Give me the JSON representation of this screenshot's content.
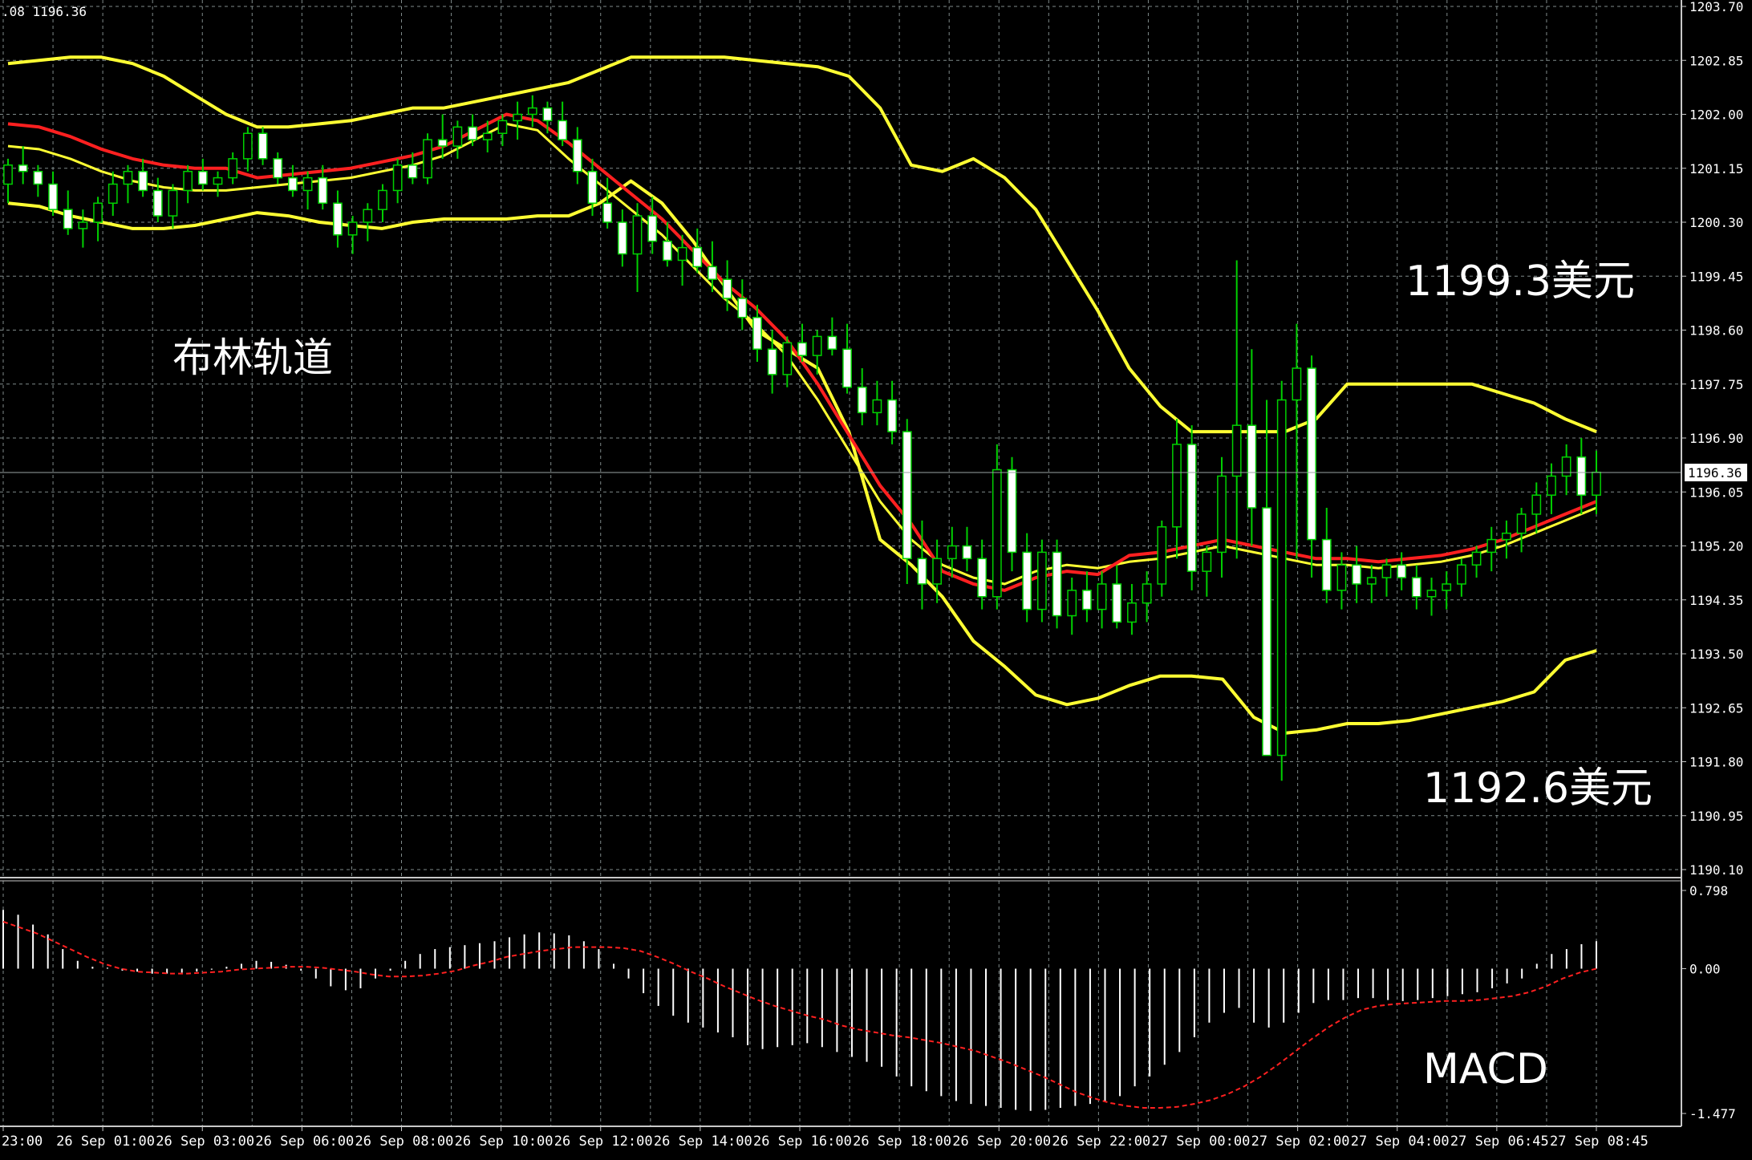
{
  "header": {
    "info": ".08 1196.36"
  },
  "annotations": {
    "bollinger_label": "布林轨道",
    "upper_price": "1199.3美元",
    "lower_price": "1192.6美元",
    "macd_label": "MACD"
  },
  "colors": {
    "background": "#000000",
    "grid": "#7f8a8a",
    "candle_up": "#000000",
    "candle_down": "#ffffff",
    "wick": "#00d000",
    "bollinger": "#ffff33",
    "middle": "#ff2020",
    "macd_signal": "#ff2020",
    "macd_hist": "#ffffff",
    "text": "#ffffff"
  },
  "chart_data": {
    "type": "candlestick",
    "instrument_note": "price chart with Bollinger Bands and MACD",
    "current_price": 1196.36,
    "price_axis": {
      "ylim": [
        1190.1,
        1203.7
      ],
      "ticks": [
        "1203.70",
        "1202.85",
        "1202.00",
        "1201.15",
        "1200.30",
        "1199.45",
        "1198.60",
        "1197.75",
        "1196.90",
        "1196.05",
        "1195.20",
        "1194.35",
        "1193.50",
        "1192.65",
        "1191.80",
        "1190.95",
        "1190.10"
      ]
    },
    "macd_axis": {
      "ylim": [
        -1.477,
        0.798
      ],
      "ticks": [
        "0.798",
        "0.00",
        "-1.477"
      ]
    },
    "time_labels": [
      "23:00",
      "26 Sep 01:00",
      "26 Sep 03:00",
      "26 Sep 06:00",
      "26 Sep 08:00",
      "26 Sep 10:00",
      "26 Sep 12:00",
      "26 Sep 14:00",
      "26 Sep 16:00",
      "26 Sep 18:00",
      "26 Sep 20:00",
      "26 Sep 22:00",
      "27 Sep 00:00",
      "27 Sep 02:00",
      "27 Sep 04:00",
      "27 Sep 06:45",
      "27 Sep 08:45"
    ],
    "candles": [
      [
        1200.9,
        1201.3,
        1200.6,
        1201.2
      ],
      [
        1201.2,
        1201.5,
        1200.9,
        1201.1
      ],
      [
        1201.1,
        1201.2,
        1200.7,
        1200.9
      ],
      [
        1200.9,
        1201.1,
        1200.4,
        1200.5
      ],
      [
        1200.5,
        1200.8,
        1200.1,
        1200.2
      ],
      [
        1200.2,
        1200.5,
        1199.9,
        1200.3
      ],
      [
        1200.3,
        1200.7,
        1200.0,
        1200.6
      ],
      [
        1200.6,
        1201.1,
        1200.4,
        1200.9
      ],
      [
        1200.9,
        1201.2,
        1200.6,
        1201.1
      ],
      [
        1201.1,
        1201.3,
        1200.7,
        1200.8
      ],
      [
        1200.8,
        1201.0,
        1200.3,
        1200.4
      ],
      [
        1200.4,
        1200.9,
        1200.2,
        1200.8
      ],
      [
        1200.8,
        1201.2,
        1200.6,
        1201.1
      ],
      [
        1201.1,
        1201.3,
        1200.8,
        1200.9
      ],
      [
        1200.9,
        1201.1,
        1200.7,
        1201.0
      ],
      [
        1201.0,
        1201.4,
        1200.9,
        1201.3
      ],
      [
        1201.3,
        1201.8,
        1201.1,
        1201.7
      ],
      [
        1201.7,
        1201.8,
        1201.2,
        1201.3
      ],
      [
        1201.3,
        1201.4,
        1200.9,
        1201.0
      ],
      [
        1201.0,
        1201.2,
        1200.7,
        1200.8
      ],
      [
        1200.8,
        1201.1,
        1200.5,
        1201.0
      ],
      [
        1201.0,
        1201.2,
        1200.5,
        1200.6
      ],
      [
        1200.6,
        1200.8,
        1199.9,
        1200.1
      ],
      [
        1200.1,
        1200.4,
        1199.8,
        1200.3
      ],
      [
        1200.3,
        1200.6,
        1200.0,
        1200.5
      ],
      [
        1200.5,
        1200.9,
        1200.3,
        1200.8
      ],
      [
        1200.8,
        1201.3,
        1200.6,
        1201.2
      ],
      [
        1201.2,
        1201.4,
        1200.9,
        1201.0
      ],
      [
        1201.0,
        1201.7,
        1200.9,
        1201.6
      ],
      [
        1201.6,
        1202.0,
        1201.3,
        1201.5
      ],
      [
        1201.5,
        1201.9,
        1201.3,
        1201.8
      ],
      [
        1201.8,
        1202.0,
        1201.5,
        1201.6
      ],
      [
        1201.6,
        1201.9,
        1201.4,
        1201.7
      ],
      [
        1201.7,
        1202.0,
        1201.5,
        1201.9
      ],
      [
        1201.9,
        1202.2,
        1201.6,
        1202.0
      ],
      [
        1202.0,
        1202.3,
        1201.8,
        1202.1
      ],
      [
        1202.1,
        1202.2,
        1201.7,
        1201.9
      ],
      [
        1201.9,
        1202.2,
        1201.5,
        1201.6
      ],
      [
        1201.6,
        1201.8,
        1200.9,
        1201.1
      ],
      [
        1201.1,
        1201.3,
        1200.4,
        1200.6
      ],
      [
        1200.6,
        1201.0,
        1200.2,
        1200.3
      ],
      [
        1200.3,
        1200.5,
        1199.6,
        1199.8
      ],
      [
        1199.8,
        1200.6,
        1199.2,
        1200.4
      ],
      [
        1200.4,
        1200.7,
        1199.8,
        1200.0
      ],
      [
        1200.0,
        1200.3,
        1199.6,
        1199.7
      ],
      [
        1199.7,
        1200.1,
        1199.3,
        1199.9
      ],
      [
        1199.9,
        1200.2,
        1199.5,
        1199.6
      ],
      [
        1199.6,
        1200.0,
        1199.2,
        1199.4
      ],
      [
        1199.4,
        1199.7,
        1198.9,
        1199.1
      ],
      [
        1199.1,
        1199.4,
        1198.6,
        1198.8
      ],
      [
        1198.8,
        1199.0,
        1198.1,
        1198.3
      ],
      [
        1198.3,
        1198.6,
        1197.6,
        1197.9
      ],
      [
        1197.9,
        1198.5,
        1197.7,
        1198.4
      ],
      [
        1198.4,
        1198.7,
        1198.1,
        1198.2
      ],
      [
        1198.2,
        1198.6,
        1197.9,
        1198.5
      ],
      [
        1198.5,
        1198.8,
        1198.2,
        1198.3
      ],
      [
        1198.3,
        1198.7,
        1197.6,
        1197.7
      ],
      [
        1197.7,
        1198.0,
        1197.1,
        1197.3
      ],
      [
        1197.3,
        1197.8,
        1197.1,
        1197.5
      ],
      [
        1197.5,
        1197.8,
        1196.8,
        1197.0
      ],
      [
        1197.0,
        1197.2,
        1194.6,
        1195.0
      ],
      [
        1195.0,
        1195.6,
        1194.2,
        1194.6
      ],
      [
        1194.6,
        1195.3,
        1194.3,
        1195.0
      ],
      [
        1195.0,
        1195.5,
        1194.7,
        1195.2
      ],
      [
        1195.2,
        1195.5,
        1194.8,
        1195.0
      ],
      [
        1195.0,
        1195.3,
        1194.2,
        1194.4
      ],
      [
        1194.4,
        1196.8,
        1194.2,
        1196.4
      ],
      [
        1196.4,
        1196.6,
        1194.8,
        1195.1
      ],
      [
        1195.1,
        1195.4,
        1194.0,
        1194.2
      ],
      [
        1194.2,
        1195.3,
        1194.0,
        1195.1
      ],
      [
        1195.1,
        1195.3,
        1193.9,
        1194.1
      ],
      [
        1194.1,
        1194.7,
        1193.8,
        1194.5
      ],
      [
        1194.5,
        1194.8,
        1194.0,
        1194.2
      ],
      [
        1194.2,
        1194.8,
        1193.9,
        1194.6
      ],
      [
        1194.6,
        1194.9,
        1193.9,
        1194.0
      ],
      [
        1194.0,
        1194.6,
        1193.8,
        1194.3
      ],
      [
        1194.3,
        1194.8,
        1194.0,
        1194.6
      ],
      [
        1194.6,
        1195.6,
        1194.4,
        1195.5
      ],
      [
        1195.5,
        1197.2,
        1195.0,
        1196.8
      ],
      [
        1196.8,
        1197.1,
        1194.5,
        1194.8
      ],
      [
        1194.8,
        1195.2,
        1194.4,
        1195.1
      ],
      [
        1195.1,
        1196.6,
        1194.7,
        1196.3
      ],
      [
        1196.3,
        1199.7,
        1195.0,
        1197.1
      ],
      [
        1197.1,
        1198.3,
        1195.2,
        1195.8
      ],
      [
        1195.8,
        1197.5,
        1193.2,
        1191.9
      ],
      [
        1191.9,
        1197.8,
        1191.5,
        1197.5
      ],
      [
        1197.5,
        1198.7,
        1195.0,
        1198.0
      ],
      [
        1198.0,
        1198.2,
        1194.7,
        1195.3
      ],
      [
        1195.3,
        1195.8,
        1194.3,
        1194.5
      ],
      [
        1194.5,
        1195.1,
        1194.2,
        1194.9
      ],
      [
        1194.9,
        1195.2,
        1194.3,
        1194.6
      ],
      [
        1194.6,
        1194.9,
        1194.3,
        1194.7
      ],
      [
        1194.7,
        1195.0,
        1194.4,
        1194.9
      ],
      [
        1194.9,
        1195.1,
        1194.5,
        1194.7
      ],
      [
        1194.7,
        1194.9,
        1194.2,
        1194.4
      ],
      [
        1194.4,
        1194.7,
        1194.1,
        1194.5
      ],
      [
        1194.5,
        1194.8,
        1194.2,
        1194.6
      ],
      [
        1194.6,
        1195.0,
        1194.4,
        1194.9
      ],
      [
        1194.9,
        1195.2,
        1194.7,
        1195.1
      ],
      [
        1195.1,
        1195.5,
        1194.8,
        1195.3
      ],
      [
        1195.3,
        1195.6,
        1195.0,
        1195.4
      ],
      [
        1195.4,
        1195.8,
        1195.1,
        1195.7
      ],
      [
        1195.7,
        1196.2,
        1195.4,
        1196.0
      ],
      [
        1196.0,
        1196.5,
        1195.7,
        1196.3
      ],
      [
        1196.3,
        1196.8,
        1196.0,
        1196.6
      ],
      [
        1196.6,
        1196.9,
        1195.7,
        1196.0
      ],
      [
        1196.0,
        1196.7,
        1195.7,
        1196.36
      ]
    ],
    "bollinger_upper": [
      1202.8,
      1202.85,
      1202.9,
      1202.9,
      1202.8,
      1202.6,
      1202.3,
      1202.0,
      1201.8,
      1201.8,
      1201.85,
      1201.9,
      1202.0,
      1202.1,
      1202.1,
      1202.2,
      1202.3,
      1202.4,
      1202.5,
      1202.7,
      1202.9,
      1202.9,
      1202.9,
      1202.9,
      1202.85,
      1202.8,
      1202.75,
      1202.6,
      1202.1,
      1201.2,
      1201.1,
      1201.3,
      1201.0,
      1200.5,
      1199.7,
      1198.9,
      1198.0,
      1197.4,
      1197.0,
      1197.0,
      1197.0,
      1197.0,
      1197.2,
      1197.75,
      1197.75,
      1197.75,
      1197.75,
      1197.75,
      1197.6,
      1197.45,
      1197.2,
      1197.0
    ],
    "bollinger_middle": [
      1201.5,
      1201.45,
      1201.3,
      1201.1,
      1200.95,
      1200.85,
      1200.8,
      1200.8,
      1200.85,
      1200.9,
      1200.95,
      1201.0,
      1201.1,
      1201.2,
      1201.35,
      1201.6,
      1201.85,
      1201.75,
      1201.3,
      1200.9,
      1200.5,
      1200.1,
      1199.6,
      1199.1,
      1198.7,
      1198.2,
      1197.5,
      1196.7,
      1195.9,
      1195.3,
      1194.9,
      1194.7,
      1194.6,
      1194.8,
      1194.9,
      1194.85,
      1194.95,
      1195.0,
      1195.1,
      1195.2,
      1195.1,
      1195.0,
      1194.9,
      1194.9,
      1194.85,
      1194.9,
      1194.95,
      1195.05,
      1195.2,
      1195.4,
      1195.6,
      1195.8
    ],
    "bollinger_lower": [
      1200.6,
      1200.55,
      1200.4,
      1200.3,
      1200.2,
      1200.2,
      1200.25,
      1200.35,
      1200.45,
      1200.4,
      1200.3,
      1200.25,
      1200.2,
      1200.3,
      1200.35,
      1200.35,
      1200.35,
      1200.4,
      1200.4,
      1200.6,
      1200.95,
      1200.6,
      1200.0,
      1199.3,
      1198.6,
      1198.3,
      1198.0,
      1197.0,
      1195.3,
      1194.9,
      1194.4,
      1193.7,
      1193.3,
      1192.85,
      1192.7,
      1192.8,
      1193.0,
      1193.15,
      1193.15,
      1193.1,
      1192.5,
      1192.25,
      1192.3,
      1192.4,
      1192.4,
      1192.45,
      1192.55,
      1192.65,
      1192.75,
      1192.9,
      1193.4,
      1193.55
    ],
    "macd_hist": [
      0.6,
      0.55,
      0.45,
      0.35,
      0.2,
      0.08,
      0.02,
      0.01,
      -0.02,
      -0.03,
      -0.05,
      -0.05,
      -0.04,
      -0.03,
      -0.01,
      0.02,
      0.05,
      0.08,
      0.07,
      0.04,
      -0.02,
      -0.1,
      -0.18,
      -0.22,
      -0.2,
      -0.1,
      -0.02,
      0.08,
      0.15,
      0.2,
      0.22,
      0.24,
      0.26,
      0.28,
      0.32,
      0.35,
      0.37,
      0.36,
      0.34,
      0.28,
      0.2,
      0.05,
      -0.1,
      -0.25,
      -0.38,
      -0.48,
      -0.55,
      -0.6,
      -0.65,
      -0.7,
      -0.78,
      -0.82,
      -0.8,
      -0.78,
      -0.76,
      -0.8,
      -0.85,
      -0.9,
      -0.95,
      -1.0,
      -1.1,
      -1.2,
      -1.25,
      -1.3,
      -1.35,
      -1.38,
      -1.4,
      -1.42,
      -1.44,
      -1.45,
      -1.44,
      -1.42,
      -1.4,
      -1.38,
      -1.35,
      -1.3,
      -1.2,
      -1.1,
      -0.98,
      -0.85,
      -0.7,
      -0.55,
      -0.45,
      -0.4,
      -0.55,
      -0.6,
      -0.55,
      -0.45,
      -0.35,
      -0.32,
      -0.32,
      -0.3,
      -0.3,
      -0.32,
      -0.33,
      -0.32,
      -0.3,
      -0.28,
      -0.26,
      -0.24,
      -0.2,
      -0.15,
      -0.1,
      0.05,
      0.15,
      0.2,
      0.25,
      0.28
    ],
    "macd_signal": [
      0.48,
      0.42,
      0.36,
      0.28,
      0.2,
      0.12,
      0.05,
      0.0,
      -0.03,
      -0.04,
      -0.05,
      -0.05,
      -0.04,
      -0.03,
      -0.01,
      0.0,
      0.01,
      0.02,
      0.02,
      0.01,
      -0.01,
      -0.03,
      -0.06,
      -0.08,
      -0.08,
      -0.07,
      -0.05,
      -0.02,
      0.03,
      0.07,
      0.12,
      0.15,
      0.18,
      0.2,
      0.22,
      0.22,
      0.22,
      0.21,
      0.18,
      0.12,
      0.05,
      -0.03,
      -0.1,
      -0.18,
      -0.25,
      -0.32,
      -0.38,
      -0.43,
      -0.48,
      -0.52,
      -0.58,
      -0.62,
      -0.65,
      -0.68,
      -0.7,
      -0.73,
      -0.76,
      -0.8,
      -0.84,
      -0.9,
      -0.96,
      -1.03,
      -1.1,
      -1.18,
      -1.26,
      -1.32,
      -1.37,
      -1.4,
      -1.42,
      -1.42,
      -1.41,
      -1.38,
      -1.34,
      -1.28,
      -1.2,
      -1.1,
      -0.98,
      -0.85,
      -0.72,
      -0.6,
      -0.5,
      -0.42,
      -0.38,
      -0.36,
      -0.35,
      -0.34,
      -0.33,
      -0.33,
      -0.32,
      -0.3,
      -0.28,
      -0.24,
      -0.18,
      -0.1,
      -0.04,
      0.0
    ]
  }
}
